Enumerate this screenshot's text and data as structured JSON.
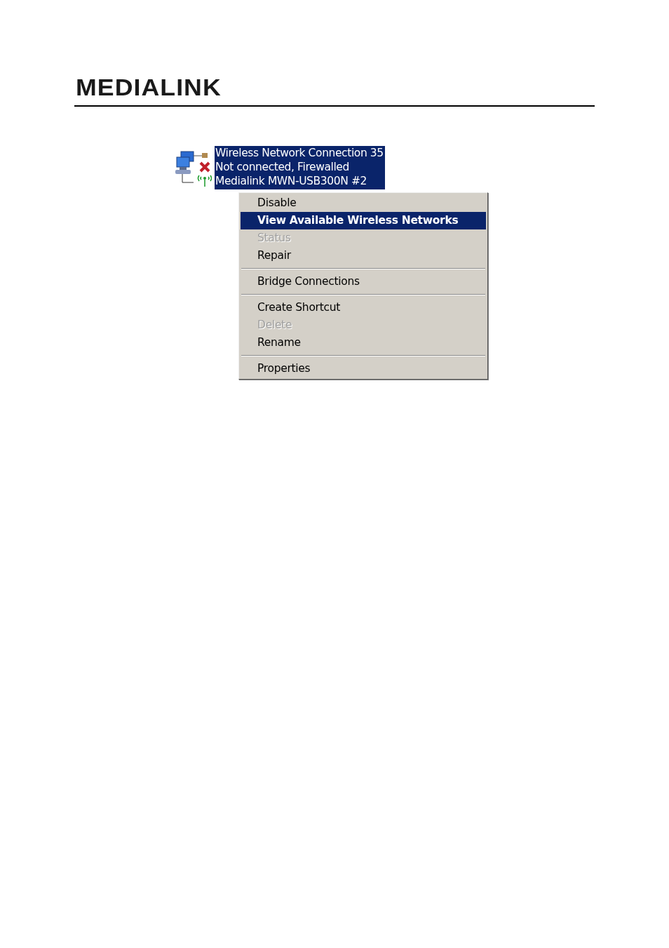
{
  "header": {
    "logo": "MEDIALINK"
  },
  "connection": {
    "lines": [
      "Wireless Network Connection 35",
      "Not connected, Firewalled",
      "Medialink MWN-USB300N #2"
    ],
    "selected": true,
    "disconnected": true
  },
  "context_menu": {
    "items": [
      {
        "kind": "item",
        "label": "Disable",
        "selected": false,
        "disabled": false
      },
      {
        "kind": "item",
        "label": "View Available Wireless Networks",
        "selected": true,
        "disabled": false
      },
      {
        "kind": "item",
        "label": "Status",
        "selected": false,
        "disabled": true
      },
      {
        "kind": "item",
        "label": "Repair",
        "selected": false,
        "disabled": false
      },
      {
        "kind": "separator"
      },
      {
        "kind": "item",
        "label": "Bridge Connections",
        "selected": false,
        "disabled": false
      },
      {
        "kind": "separator"
      },
      {
        "kind": "item",
        "label": "Create Shortcut",
        "selected": false,
        "disabled": false
      },
      {
        "kind": "item",
        "label": "Delete",
        "selected": false,
        "disabled": true
      },
      {
        "kind": "item",
        "label": "Rename",
        "selected": false,
        "disabled": false
      },
      {
        "kind": "separator"
      },
      {
        "kind": "item",
        "label": "Properties",
        "selected": false,
        "disabled": false
      }
    ]
  }
}
